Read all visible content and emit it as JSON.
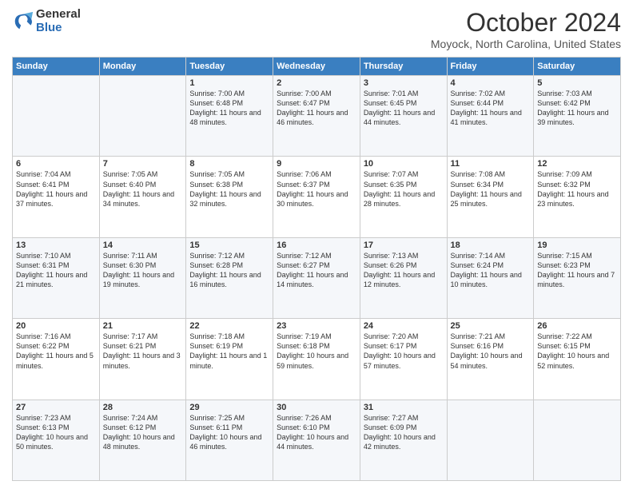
{
  "logo": {
    "general": "General",
    "blue": "Blue"
  },
  "header": {
    "title": "October 2024",
    "location": "Moyock, North Carolina, United States"
  },
  "days_of_week": [
    "Sunday",
    "Monday",
    "Tuesday",
    "Wednesday",
    "Thursday",
    "Friday",
    "Saturday"
  ],
  "weeks": [
    [
      {
        "day": "",
        "text": ""
      },
      {
        "day": "",
        "text": ""
      },
      {
        "day": "1",
        "text": "Sunrise: 7:00 AM\nSunset: 6:48 PM\nDaylight: 11 hours and 48 minutes."
      },
      {
        "day": "2",
        "text": "Sunrise: 7:00 AM\nSunset: 6:47 PM\nDaylight: 11 hours and 46 minutes."
      },
      {
        "day": "3",
        "text": "Sunrise: 7:01 AM\nSunset: 6:45 PM\nDaylight: 11 hours and 44 minutes."
      },
      {
        "day": "4",
        "text": "Sunrise: 7:02 AM\nSunset: 6:44 PM\nDaylight: 11 hours and 41 minutes."
      },
      {
        "day": "5",
        "text": "Sunrise: 7:03 AM\nSunset: 6:42 PM\nDaylight: 11 hours and 39 minutes."
      }
    ],
    [
      {
        "day": "6",
        "text": "Sunrise: 7:04 AM\nSunset: 6:41 PM\nDaylight: 11 hours and 37 minutes."
      },
      {
        "day": "7",
        "text": "Sunrise: 7:05 AM\nSunset: 6:40 PM\nDaylight: 11 hours and 34 minutes."
      },
      {
        "day": "8",
        "text": "Sunrise: 7:05 AM\nSunset: 6:38 PM\nDaylight: 11 hours and 32 minutes."
      },
      {
        "day": "9",
        "text": "Sunrise: 7:06 AM\nSunset: 6:37 PM\nDaylight: 11 hours and 30 minutes."
      },
      {
        "day": "10",
        "text": "Sunrise: 7:07 AM\nSunset: 6:35 PM\nDaylight: 11 hours and 28 minutes."
      },
      {
        "day": "11",
        "text": "Sunrise: 7:08 AM\nSunset: 6:34 PM\nDaylight: 11 hours and 25 minutes."
      },
      {
        "day": "12",
        "text": "Sunrise: 7:09 AM\nSunset: 6:32 PM\nDaylight: 11 hours and 23 minutes."
      }
    ],
    [
      {
        "day": "13",
        "text": "Sunrise: 7:10 AM\nSunset: 6:31 PM\nDaylight: 11 hours and 21 minutes."
      },
      {
        "day": "14",
        "text": "Sunrise: 7:11 AM\nSunset: 6:30 PM\nDaylight: 11 hours and 19 minutes."
      },
      {
        "day": "15",
        "text": "Sunrise: 7:12 AM\nSunset: 6:28 PM\nDaylight: 11 hours and 16 minutes."
      },
      {
        "day": "16",
        "text": "Sunrise: 7:12 AM\nSunset: 6:27 PM\nDaylight: 11 hours and 14 minutes."
      },
      {
        "day": "17",
        "text": "Sunrise: 7:13 AM\nSunset: 6:26 PM\nDaylight: 11 hours and 12 minutes."
      },
      {
        "day": "18",
        "text": "Sunrise: 7:14 AM\nSunset: 6:24 PM\nDaylight: 11 hours and 10 minutes."
      },
      {
        "day": "19",
        "text": "Sunrise: 7:15 AM\nSunset: 6:23 PM\nDaylight: 11 hours and 7 minutes."
      }
    ],
    [
      {
        "day": "20",
        "text": "Sunrise: 7:16 AM\nSunset: 6:22 PM\nDaylight: 11 hours and 5 minutes."
      },
      {
        "day": "21",
        "text": "Sunrise: 7:17 AM\nSunset: 6:21 PM\nDaylight: 11 hours and 3 minutes."
      },
      {
        "day": "22",
        "text": "Sunrise: 7:18 AM\nSunset: 6:19 PM\nDaylight: 11 hours and 1 minute."
      },
      {
        "day": "23",
        "text": "Sunrise: 7:19 AM\nSunset: 6:18 PM\nDaylight: 10 hours and 59 minutes."
      },
      {
        "day": "24",
        "text": "Sunrise: 7:20 AM\nSunset: 6:17 PM\nDaylight: 10 hours and 57 minutes."
      },
      {
        "day": "25",
        "text": "Sunrise: 7:21 AM\nSunset: 6:16 PM\nDaylight: 10 hours and 54 minutes."
      },
      {
        "day": "26",
        "text": "Sunrise: 7:22 AM\nSunset: 6:15 PM\nDaylight: 10 hours and 52 minutes."
      }
    ],
    [
      {
        "day": "27",
        "text": "Sunrise: 7:23 AM\nSunset: 6:13 PM\nDaylight: 10 hours and 50 minutes."
      },
      {
        "day": "28",
        "text": "Sunrise: 7:24 AM\nSunset: 6:12 PM\nDaylight: 10 hours and 48 minutes."
      },
      {
        "day": "29",
        "text": "Sunrise: 7:25 AM\nSunset: 6:11 PM\nDaylight: 10 hours and 46 minutes."
      },
      {
        "day": "30",
        "text": "Sunrise: 7:26 AM\nSunset: 6:10 PM\nDaylight: 10 hours and 44 minutes."
      },
      {
        "day": "31",
        "text": "Sunrise: 7:27 AM\nSunset: 6:09 PM\nDaylight: 10 hours and 42 minutes."
      },
      {
        "day": "",
        "text": ""
      },
      {
        "day": "",
        "text": ""
      }
    ]
  ]
}
